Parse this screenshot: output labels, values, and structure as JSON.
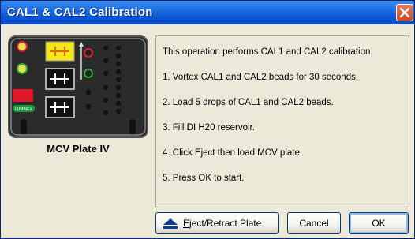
{
  "window": {
    "title": "CAL1 & CAL2 Calibration"
  },
  "image": {
    "caption": "MCV Plate IV",
    "label_text": "LUMINEX"
  },
  "instructions": [
    "This operation performs CAL1 and CAL2 calibration.",
    "1. Vortex CAL1 and CAL2 beads for 30 seconds.",
    "2. Load 5 drops of CAL1 and CAL2 beads.",
    "3. Fill DI H20 reservoir.",
    "4. Click Eject then load MCV plate.",
    "5. Press OK to start."
  ],
  "buttons": {
    "eject_mnemonic": "E",
    "eject_rest": "ject/Retract Plate",
    "cancel": "Cancel",
    "ok": "OK"
  },
  "icons": {
    "close": "close-icon",
    "eject": "eject-icon"
  },
  "colors": {
    "title_bar": "#0a55d6",
    "close_button": "#d2461f",
    "panel_bg": "#ece9d8"
  }
}
